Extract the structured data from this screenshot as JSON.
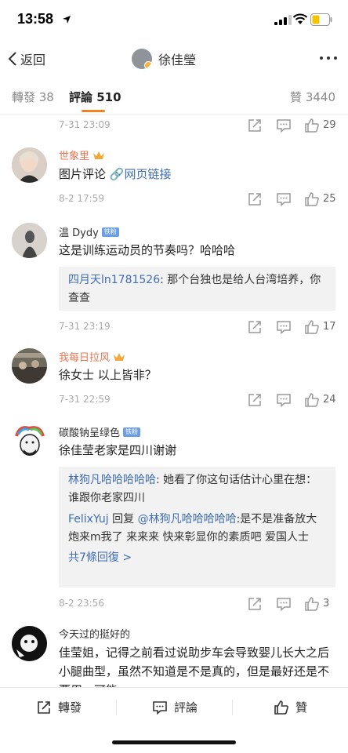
{
  "status": {
    "time": "13:58"
  },
  "nav": {
    "back_label": "返回",
    "title": "徐佳瑩"
  },
  "tabs": {
    "repost": "轉發 38",
    "comment": "評論 510",
    "like": "贊 3440"
  },
  "colors": {
    "accent": "#f58220",
    "link": "#3f6db2",
    "vip_name": "#eb7350"
  },
  "comments": [
    {
      "time": "7-31 23:09",
      "likes": "29"
    },
    {
      "name": "世象里",
      "text_a": "图片评论",
      "text_link": "🔗网页链接",
      "time": "8-2 17:59",
      "likes": "25"
    },
    {
      "name": "温 Dydy",
      "badge": "铁粉",
      "text": "这是训练运动员的节奏吗？哈哈哈",
      "replies": [
        {
          "name": "四月天ln1781526",
          "text": ": 那个台独也是给人台湾培养，你查查"
        }
      ],
      "time": "7-31 23:19",
      "likes": "17"
    },
    {
      "name": "我每日拉风",
      "text": "徐女士 以上皆非？",
      "time": "7-31 22:59",
      "likes": "24"
    },
    {
      "name": "碳酸钠呈绿色",
      "badge": "铁粉",
      "text": "徐佳莹老家是四川谢谢",
      "replies": [
        {
          "name": "林狗凡哈哈哈哈哈",
          "text": ": 她看了你这句话估计心里在想：谁跟你老家四川"
        },
        {
          "name": "FelixYuj",
          "mid": " 回复 ",
          "at": "@林狗凡哈哈哈哈哈",
          "text": ":是不是准备放大炮来m我了  来来来  快来彰显你的素质吧   爱国人士"
        }
      ],
      "more_replies": "共7條回復 >",
      "time": "8-2 23:56",
      "likes": "3"
    },
    {
      "name": "今天过的挺好的",
      "text": "佳莹姐，记得之前看过说助步车会导致婴儿长大之后小腿曲型，虽然不知道是不是真的，但是最好还是不要用…可能"
    }
  ],
  "bottom": {
    "repost": "轉發",
    "comment": "評論",
    "like": "贊"
  },
  "icons": [
    "location-arrow-icon",
    "signal-icon",
    "wifi-icon",
    "battery-icon",
    "back-chevron-icon",
    "more-dots-icon",
    "share-icon",
    "reply-icon",
    "thumbs-up-icon",
    "crown-icon",
    "link-icon"
  ]
}
